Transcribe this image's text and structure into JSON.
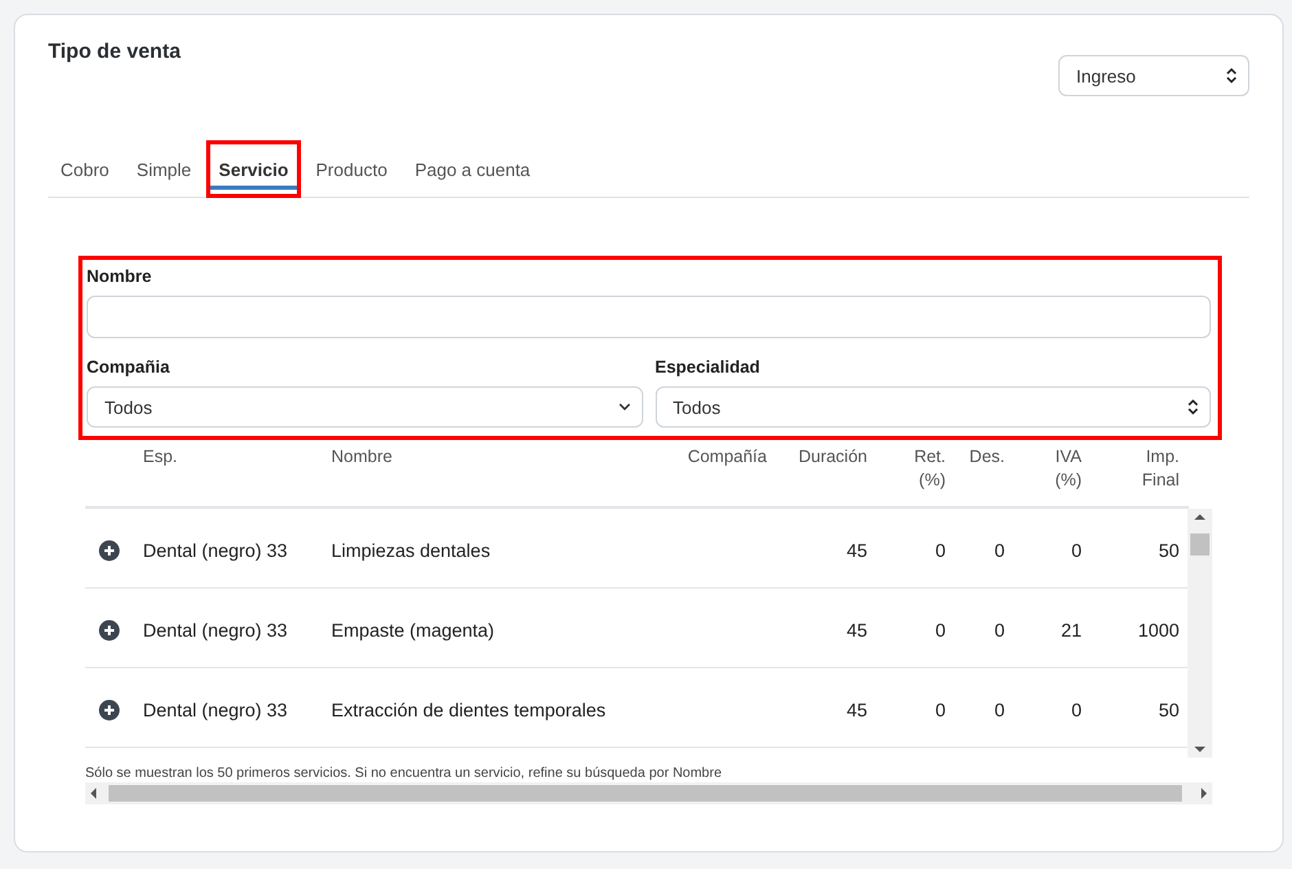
{
  "title": "Tipo de venta",
  "type_select": {
    "value": "Ingreso"
  },
  "tabs": [
    {
      "label": "Cobro",
      "selected": false,
      "highlighted": false
    },
    {
      "label": "Simple",
      "selected": false,
      "highlighted": false
    },
    {
      "label": "Servicio",
      "selected": true,
      "highlighted": true
    },
    {
      "label": "Producto",
      "selected": false,
      "highlighted": false
    },
    {
      "label": "Pago a cuenta",
      "selected": false,
      "highlighted": false
    }
  ],
  "filters": {
    "highlighted": true,
    "name": {
      "label": "Nombre"
    },
    "company": {
      "label": "Compañia",
      "value": "Todos"
    },
    "specialty": {
      "label": "Especialidad",
      "value": "Todos"
    }
  },
  "table": {
    "columns": [
      "Esp.",
      "Nombre",
      "Compañía",
      "Duración",
      "Ret. (%)",
      "Des.",
      "IVA (%)",
      "Imp. Final"
    ],
    "rows": [
      [
        "Dental (negro) 33",
        "Limpiezas dentales",
        "",
        "45",
        "0",
        "0",
        "0",
        "50"
      ],
      [
        "Dental (negro) 33",
        "Empaste (magenta)",
        "",
        "45",
        "0",
        "0",
        "21",
        "1000"
      ],
      [
        "Dental (negro) 33",
        "Extracción de dientes temporales",
        "",
        "45",
        "0",
        "0",
        "0",
        "50"
      ]
    ]
  },
  "note": "Sólo se muestran los 50 primeros servicios. Si no encuentra un servicio, refine su búsqueda por Nombre"
}
